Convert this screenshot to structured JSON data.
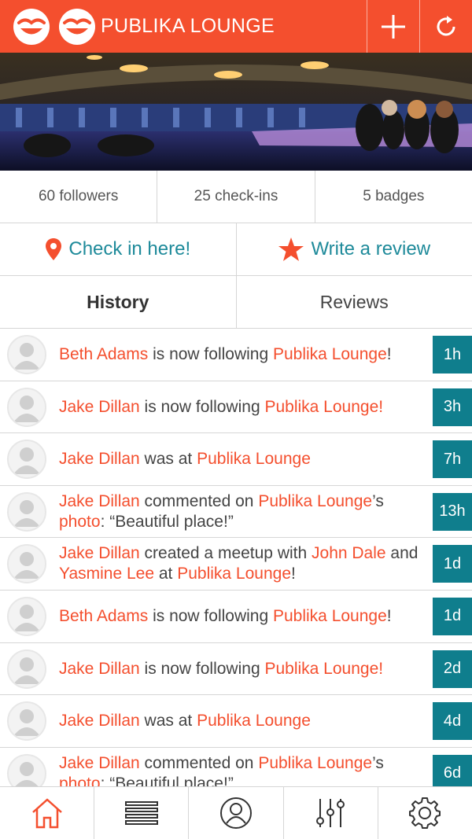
{
  "header": {
    "title": "PUBLIKA LOUNGE",
    "logo_icon": "smiley-logo-icon",
    "add_icon": "plus-icon",
    "refresh_icon": "refresh-icon"
  },
  "colors": {
    "brand": "#f44f2e",
    "accent_teal": "#0f7e8d",
    "link_teal": "#1e8a9a"
  },
  "stats": {
    "followers": "60 followers",
    "checkins": "25 check-ins",
    "badges": "5 badges"
  },
  "actions": {
    "checkin_label": "Check in here!",
    "review_label": "Write a review"
  },
  "tabs": {
    "history": "History",
    "reviews": "Reviews"
  },
  "feed": [
    {
      "name": "Beth Adams",
      "action": " is now following ",
      "place": "Publika Lounge",
      "tail": "!",
      "time": "1h"
    },
    {
      "name": "Jake Dillan",
      "action": " is now following ",
      "place": "Publika Lounge!",
      "tail": "",
      "time": "3h"
    },
    {
      "name": "Jake Dillan",
      "action": " was at ",
      "place": "Publika Lounge",
      "tail": "",
      "time": "7h"
    },
    {
      "name": "Jake Dillan",
      "action": " commented on ",
      "place": "Publika Lounge",
      "tail": "’s",
      "second_link": "photo",
      "second_tail": ": “Beautiful place!”",
      "time": "13h"
    },
    {
      "name": "Jake Dillan",
      "action": " created a meetup with ",
      "person2": "John Dale",
      "and": " and ",
      "person3": "Yasmine Lee",
      "at": " at ",
      "place": "Publika Lounge",
      "tail": "!",
      "time": "1d"
    },
    {
      "name": "Beth Adams",
      "action": " is now following ",
      "place": "Publika Lounge",
      "tail": "!",
      "time": "1d"
    },
    {
      "name": "Jake Dillan",
      "action": " is now following ",
      "place": "Publika Lounge!",
      "tail": "",
      "time": "2d"
    },
    {
      "name": "Jake Dillan",
      "action": " was at ",
      "place": "Publika Lounge",
      "tail": "",
      "time": "4d"
    },
    {
      "name": "Jake Dillan",
      "action": " commented on ",
      "place": "Publika Lounge",
      "tail": "’s",
      "second_link": "photo",
      "second_tail": ": “Beautiful place!”",
      "time": "6d"
    }
  ],
  "nav": [
    {
      "icon": "home-icon"
    },
    {
      "icon": "list-icon"
    },
    {
      "icon": "profile-icon"
    },
    {
      "icon": "sliders-icon"
    },
    {
      "icon": "gear-icon"
    }
  ]
}
